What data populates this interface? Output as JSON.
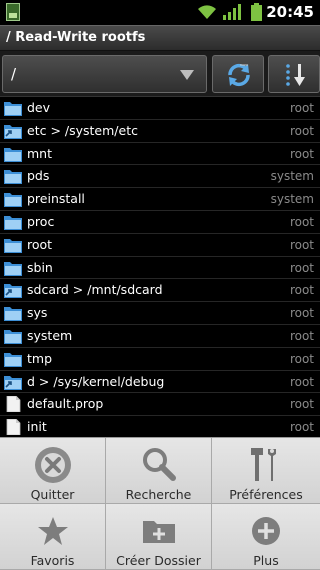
{
  "status_bar": {
    "time": "20:45",
    "icons": [
      "notification-icon",
      "wifi-icon",
      "signal-icon",
      "battery-icon"
    ]
  },
  "title": "/ Read-Write rootfs",
  "toolbar": {
    "path_value": "/",
    "refresh_icon": "refresh-icon",
    "sort_icon": "sort-icon"
  },
  "files": [
    {
      "name": "dev",
      "owner": "root",
      "icon": "folder-icon"
    },
    {
      "name": "etc > /system/etc",
      "owner": "root",
      "icon": "folder-link-icon"
    },
    {
      "name": "mnt",
      "owner": "root",
      "icon": "folder-icon"
    },
    {
      "name": "pds",
      "owner": "system",
      "icon": "folder-icon"
    },
    {
      "name": "preinstall",
      "owner": "system",
      "icon": "folder-icon"
    },
    {
      "name": "proc",
      "owner": "root",
      "icon": "folder-icon"
    },
    {
      "name": "root",
      "owner": "root",
      "icon": "folder-icon"
    },
    {
      "name": "sbin",
      "owner": "root",
      "icon": "folder-icon"
    },
    {
      "name": "sdcard > /mnt/sdcard",
      "owner": "root",
      "icon": "folder-link-icon"
    },
    {
      "name": "sys",
      "owner": "root",
      "icon": "folder-icon"
    },
    {
      "name": "system",
      "owner": "root",
      "icon": "folder-icon"
    },
    {
      "name": "tmp",
      "owner": "root",
      "icon": "folder-icon"
    },
    {
      "name": "d > /sys/kernel/debug",
      "owner": "root",
      "icon": "folder-link-icon"
    },
    {
      "name": "default.prop",
      "owner": "root",
      "icon": "file-icon"
    },
    {
      "name": "init",
      "owner": "root",
      "icon": "file-icon"
    }
  ],
  "menu": [
    {
      "label": "Quitter",
      "icon": "close-circle-icon"
    },
    {
      "label": "Recherche",
      "icon": "search-icon"
    },
    {
      "label": "Préférences",
      "icon": "tools-icon"
    },
    {
      "label": "Favoris",
      "icon": "star-icon"
    },
    {
      "label": "Créer Dossier",
      "icon": "new-folder-icon"
    },
    {
      "label": "Plus",
      "icon": "plus-circle-icon"
    }
  ]
}
